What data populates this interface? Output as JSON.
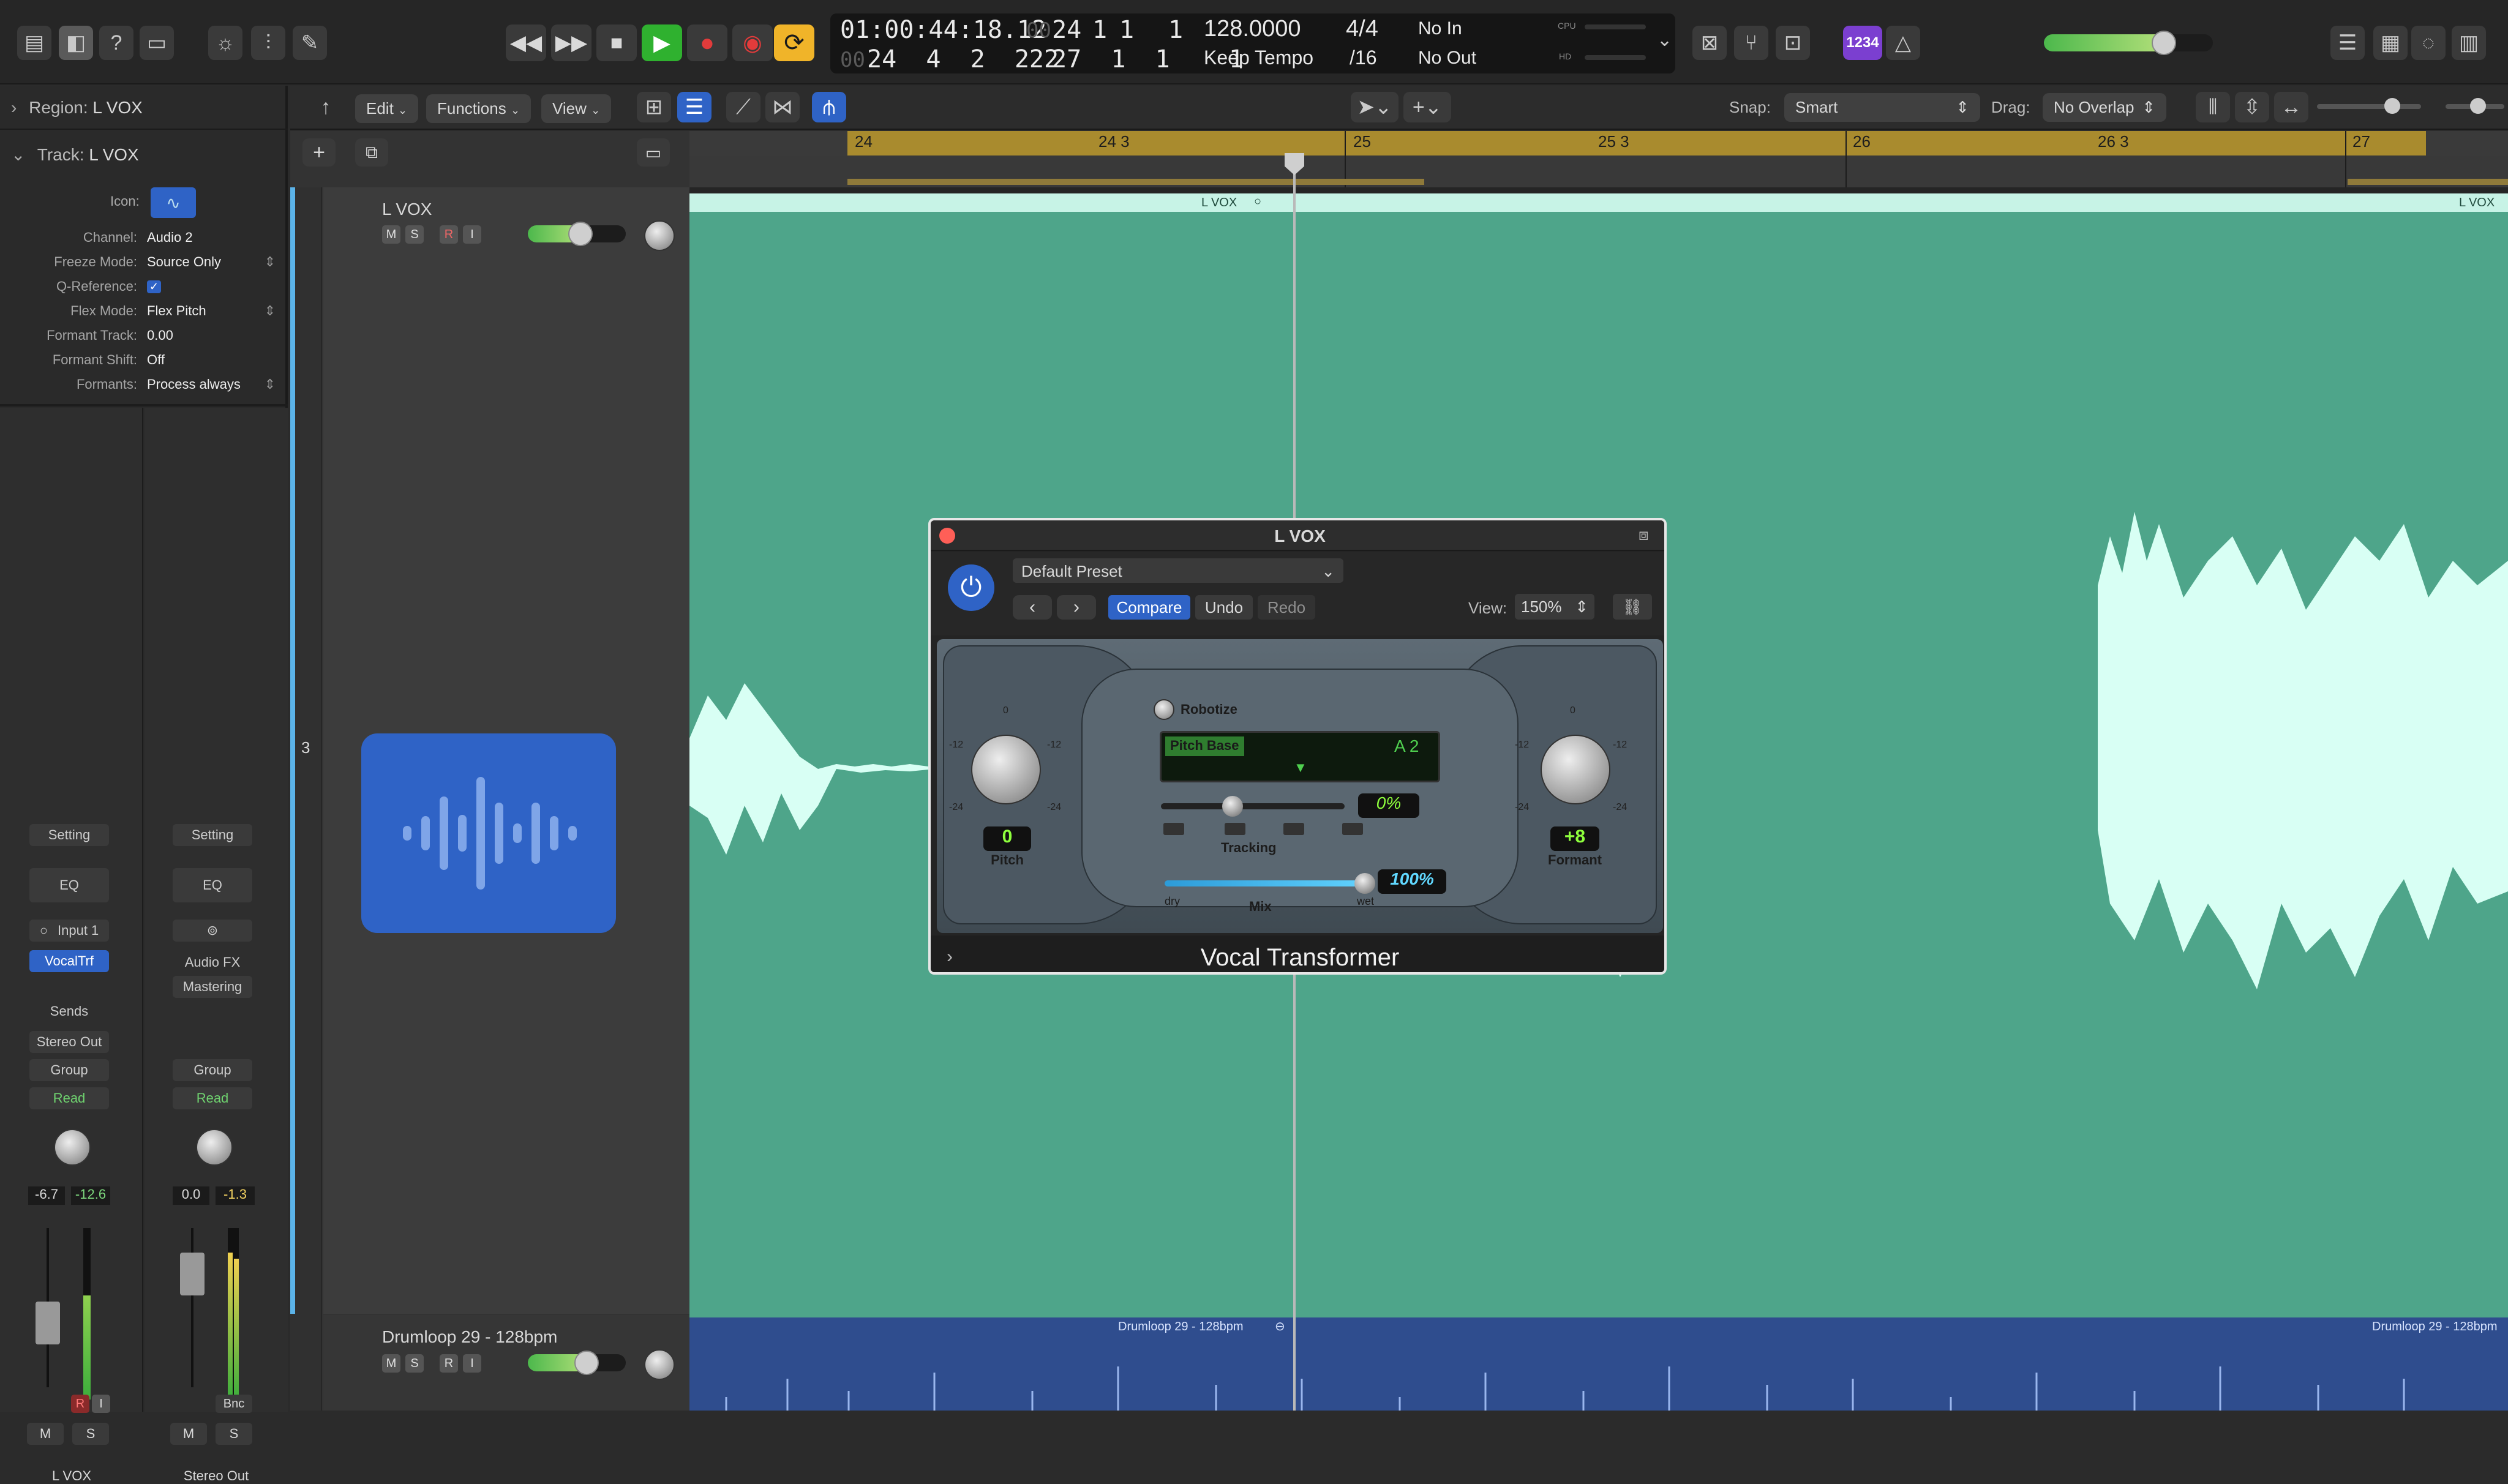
{
  "transport": {
    "position_time": "01:00:44:18.12",
    "position_bars": [
      "24",
      "1",
      "1",
      "1"
    ],
    "position_bars_prefix": "00",
    "sub_time": "24  4  2  222",
    "sub_time_prefix": "00",
    "sub_bars": [
      "27",
      "1",
      "1",
      "1"
    ],
    "tempo": "128.0000",
    "tempo_mode": "Keep Tempo",
    "time_sig": "4/4",
    "division": "/16",
    "in_label": "No In",
    "out_label": "No Out",
    "cpu_label": "CPU",
    "hd_label": "HD",
    "badge_count": "1234"
  },
  "toolbar": {
    "edit": "Edit",
    "functions": "Functions",
    "view": "View",
    "snap_label": "Snap:",
    "snap_value": "Smart",
    "drag_label": "Drag:",
    "drag_value": "No Overlap"
  },
  "inspector": {
    "region_label": "Region:",
    "region_name": "L VOX",
    "track_label": "Track:",
    "track_name": "L VOX",
    "icon_label": "Icon:",
    "rows": [
      {
        "k": "Channel:",
        "v": "Audio 2"
      },
      {
        "k": "Freeze Mode:",
        "v": "Source Only"
      },
      {
        "k": "Q-Reference:",
        "v": "✓"
      },
      {
        "k": "Flex Mode:",
        "v": "Flex Pitch"
      },
      {
        "k": "Formant Track:",
        "v": "0.00"
      },
      {
        "k": "Formant Shift:",
        "v": "Off"
      },
      {
        "k": "Formants:",
        "v": "Process always"
      }
    ]
  },
  "strips": {
    "left": {
      "setting": "Setting",
      "eq": "EQ",
      "input": "Input 1",
      "plugin": "VocalTrf",
      "sends": "Sends",
      "output": "Stereo Out",
      "group": "Group",
      "read": "Read",
      "vol": "-6.7",
      "peak": "-12.6",
      "name": "L VOX",
      "rec": "R",
      "inmon": "I",
      "m": "M",
      "s": "S"
    },
    "right": {
      "setting": "Setting",
      "eq": "EQ",
      "audio_fx": "Audio FX",
      "mastering": "Mastering",
      "group": "Group",
      "read": "Read",
      "vol": "0.0",
      "peak": "-1.3",
      "bnc": "Bnc",
      "name": "Stereo Out",
      "m": "M",
      "s": "S"
    }
  },
  "tracks": [
    {
      "number": "3",
      "name": "L VOX",
      "m": "M",
      "s": "S",
      "r": "R",
      "i": "I"
    },
    {
      "name": "Drumloop 29 - 128bpm",
      "m": "M",
      "s": "S",
      "r": "R",
      "i": "I"
    }
  ],
  "ruler": {
    "marks": [
      "24",
      "24 3",
      "25",
      "25 3",
      "26",
      "26 3",
      "27"
    ]
  },
  "regions": {
    "vox": "L VOX",
    "drum": "Drumloop 29 - 128bpm"
  },
  "plugin": {
    "window_title": "L VOX",
    "preset": "Default Preset",
    "compare": "Compare",
    "undo": "Undo",
    "redo": "Redo",
    "view_label": "View:",
    "view_value": "150%",
    "robotize": "Robotize",
    "pitch_base_label": "Pitch Base",
    "pitch_base_note": "A 2",
    "tracking_label": "Tracking",
    "tracking_value": "0%",
    "pitch_value": "0",
    "pitch_label": "Pitch",
    "formant_value": "+8",
    "formant_label": "Formant",
    "mix_value": "100%",
    "mix_label": "Mix",
    "dry": "dry",
    "wet": "wet",
    "scale": {
      "top": "0",
      "l1": "-12",
      "r1": "-12",
      "l2": "-24",
      "r2": "-24"
    },
    "name": "Vocal Transformer"
  },
  "colors": {
    "region_green": "#4ea58a",
    "waveform": "#d8fff4",
    "drum_blue": "#2f4d8e",
    "accent_blue": "#2f63c6",
    "play_green": "#2fb12f",
    "record_red": "#e23b3b",
    "cycle_yellow": "#f0b429"
  }
}
